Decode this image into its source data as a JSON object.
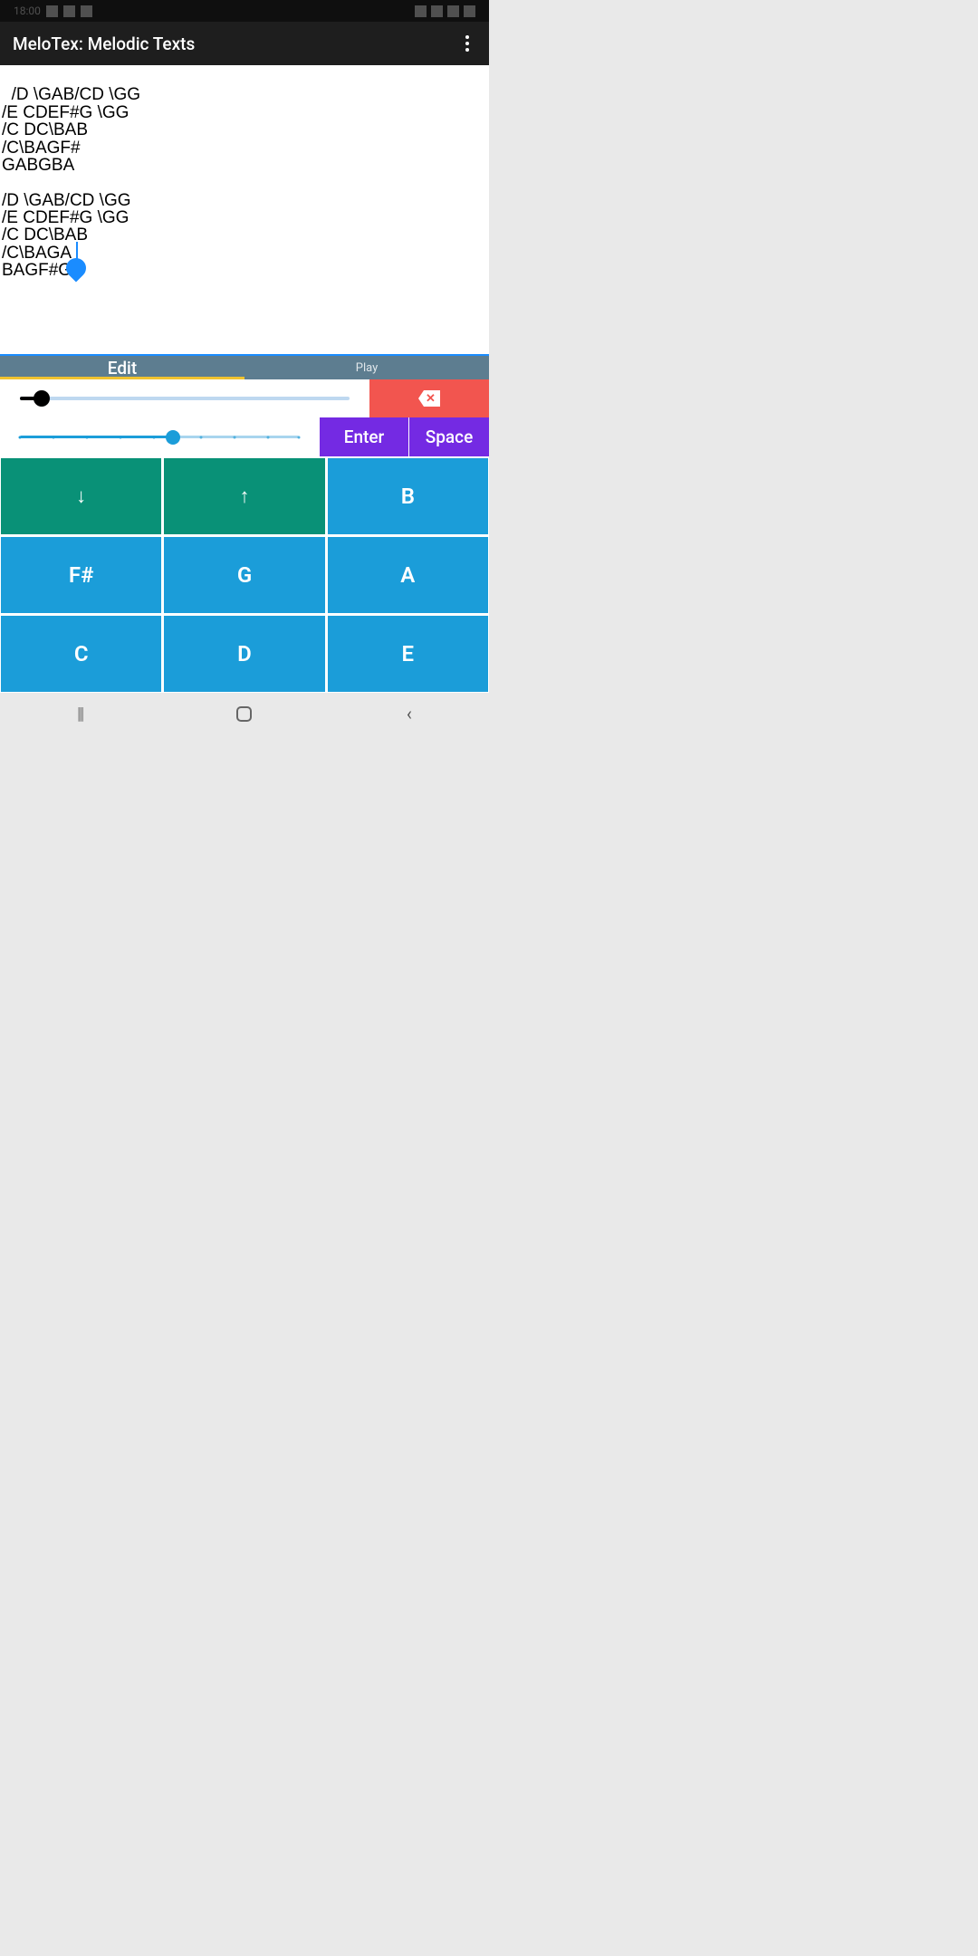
{
  "status": {
    "time": "18:00"
  },
  "app": {
    "title": "MeloTex: Melodic Texts"
  },
  "editor": {
    "content": "/D \\GAB/CD \\GG\n/E CDEF#G \\GG\n/C DC\\BAB\n/C\\BAGF#\nGABGBA\n\n/D \\GAB/CD \\GG\n/E CDEF#G \\GG\n/C DC\\BAB\n/C\\BAGA\nBAGF#G"
  },
  "tabs": {
    "edit": "Edit",
    "play": "Play"
  },
  "buttons": {
    "enter": "Enter",
    "space": "Space"
  },
  "keys": {
    "down": "↓",
    "up": "↑",
    "b": "B",
    "fsharp": "F#",
    "g": "G",
    "a": "A",
    "c": "C",
    "d": "D",
    "e": "E"
  },
  "nav": {
    "recent": "|||",
    "back": "‹"
  }
}
